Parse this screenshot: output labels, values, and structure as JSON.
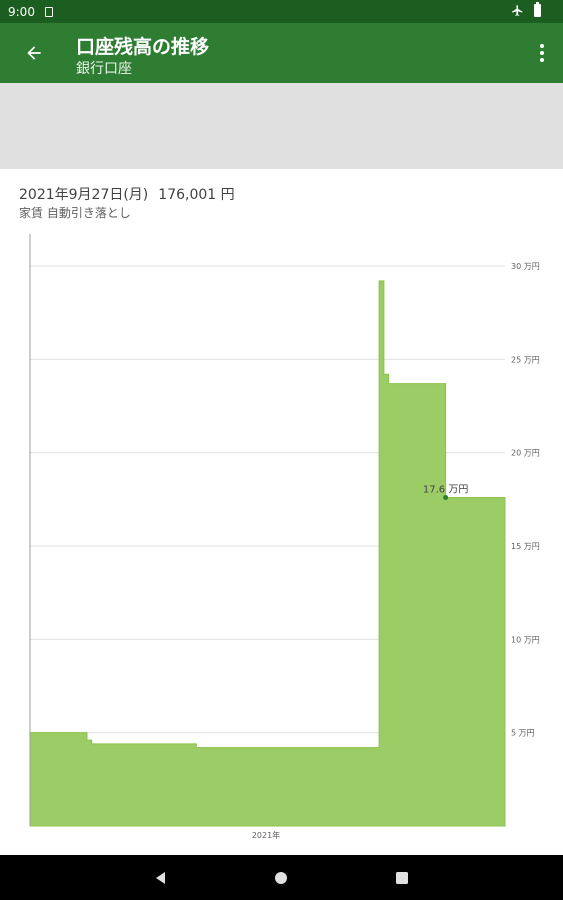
{
  "status_bar": {
    "time": "9:00",
    "icons": [
      "sim-icon",
      "airplane-icon",
      "battery-icon"
    ]
  },
  "app_bar": {
    "title": "口座残高の推移",
    "subtitle": "銀行口座",
    "back_icon": "arrow-back-icon",
    "more_icon": "more-vert-icon"
  },
  "info": {
    "date": "2021年9月27日(月)",
    "amount": "176,001 円",
    "description": "家賃 自動引き落とし"
  },
  "chart_data": {
    "type": "area",
    "x_label": "2021年",
    "ylim": [
      0,
      30
    ],
    "unit": "万円",
    "y_ticks": [
      "5 万円",
      "10 万円",
      "15 万円",
      "20 万円",
      "25 万円",
      "30 万円"
    ],
    "color": "#9ccc65",
    "steps": [
      {
        "x": 0.0,
        "y": 5.0
      },
      {
        "x": 0.12,
        "y": 4.6
      },
      {
        "x": 0.13,
        "y": 4.4
      },
      {
        "x": 0.35,
        "y": 4.2
      },
      {
        "x": 0.735,
        "y": 29.2
      },
      {
        "x": 0.745,
        "y": 24.2
      },
      {
        "x": 0.755,
        "y": 23.7
      },
      {
        "x": 0.875,
        "y": 17.6
      },
      {
        "x": 1.0,
        "y": 17.6
      }
    ],
    "selected": {
      "label": "17.6 万円",
      "x": 0.875,
      "y": 17.6
    }
  },
  "nav": {
    "back_icon": "nav-back-icon",
    "home_icon": "nav-home-icon",
    "recents_icon": "nav-recents-icon"
  }
}
